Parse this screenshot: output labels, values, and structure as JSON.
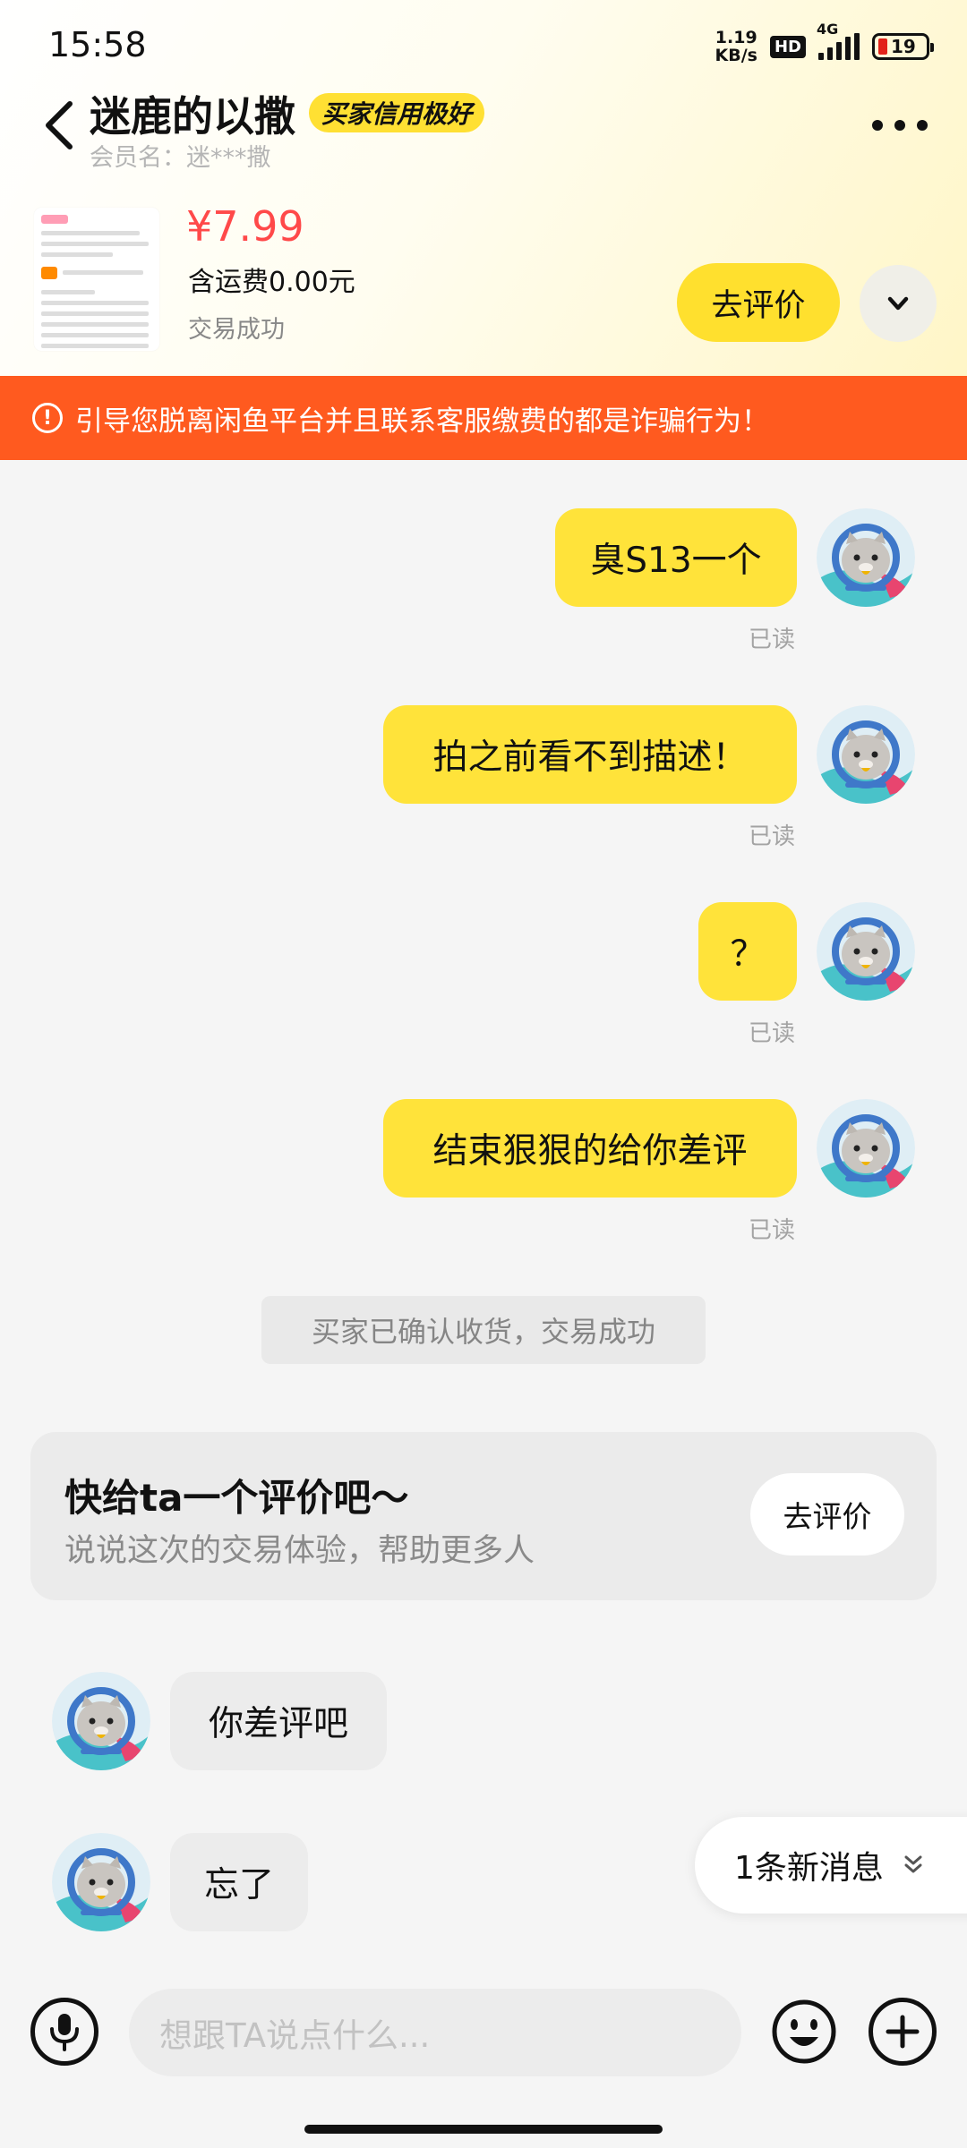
{
  "status_bar": {
    "time": "15:58",
    "net_speed_value": "1.19",
    "net_speed_unit": "KB/s",
    "hd": "HD",
    "network": "4G",
    "battery": "19"
  },
  "header": {
    "title": "迷鹿的以撒",
    "credit_badge": "买家信用极好",
    "member_label": "会员名：迷***撒"
  },
  "product": {
    "price": "¥7.99",
    "shipping": "含运费0.00元",
    "status": "交易成功",
    "review_button": "去评价"
  },
  "warning": {
    "text": "引导您脱离闲鱼平台并且联系客服缴费的都是诈骗行为！"
  },
  "messages": {
    "m1": "臭S13一个",
    "m2": "拍之前看不到描述！",
    "m3": "？",
    "m4": "结束狠狠的给你差评",
    "read_label": "已读",
    "system": "买家已确认收货，交易成功",
    "t1": "你差评吧",
    "t2": "忘了"
  },
  "review_card": {
    "title": "快给ta一个评价吧～",
    "subtitle": "说说这次的交易体验，帮助更多人",
    "button": "去评价"
  },
  "new_message": "1条新消息",
  "input": {
    "placeholder": "想跟TA说点什么..."
  },
  "colors": {
    "accent_yellow": "#ffe33a",
    "warning_orange": "#ff5a1f",
    "price_red": "#ff4949"
  }
}
